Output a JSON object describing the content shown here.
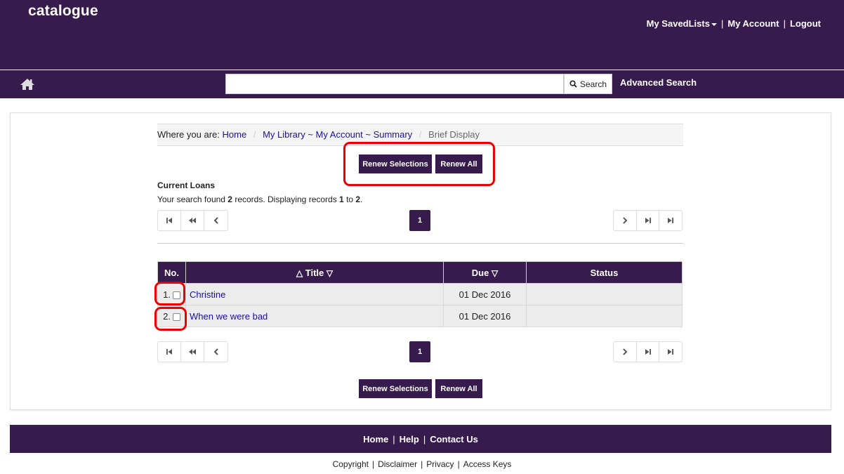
{
  "header": {
    "logo": "catalogue",
    "nav": {
      "saved_lists": "My SavedLists",
      "account": "My Account",
      "logout": "Logout",
      "sep": "|"
    }
  },
  "search": {
    "placeholder": "",
    "button_label": "Search",
    "advanced_label": "Advanced Search"
  },
  "breadcrumb": {
    "prefix": "Where you are:",
    "items": [
      "Home",
      "My Library ~ My Account ~ Summary"
    ],
    "current": "Brief Display",
    "sep": "/"
  },
  "actions": {
    "renew_selections": "Renew Selections",
    "renew_all": "Renew All"
  },
  "loans": {
    "section_title": "Current Loans",
    "result_text_1": "Your search found ",
    "found": "2",
    "result_text_2": " records. Displaying records ",
    "from": "1",
    "result_text_3": " to ",
    "to": "2",
    "result_text_4": ".",
    "current_page": "1",
    "columns": {
      "no": "No.",
      "title": "Title",
      "due": "Due",
      "status": "Status"
    },
    "rows": [
      {
        "no": "1.",
        "title": "Christine",
        "due": "01 Dec 2016",
        "status": ""
      },
      {
        "no": "2.",
        "title": "When we were bad",
        "due": "01 Dec 2016",
        "status": ""
      }
    ]
  },
  "footer": {
    "links": [
      "Home",
      "Help",
      "Contact Us"
    ],
    "sep": "|",
    "bottom_links": [
      "Copyright",
      "Disclaimer",
      "Privacy",
      "Access Keys"
    ]
  },
  "colors": {
    "brand": "#371b4d",
    "highlight": "#ee0000",
    "link": "#1a0dab"
  },
  "icons": [
    "home-icon",
    "search-icon",
    "first-page-icon",
    "fast-back-icon",
    "prev-icon",
    "next-icon",
    "fast-forward-icon",
    "last-page-icon"
  ]
}
